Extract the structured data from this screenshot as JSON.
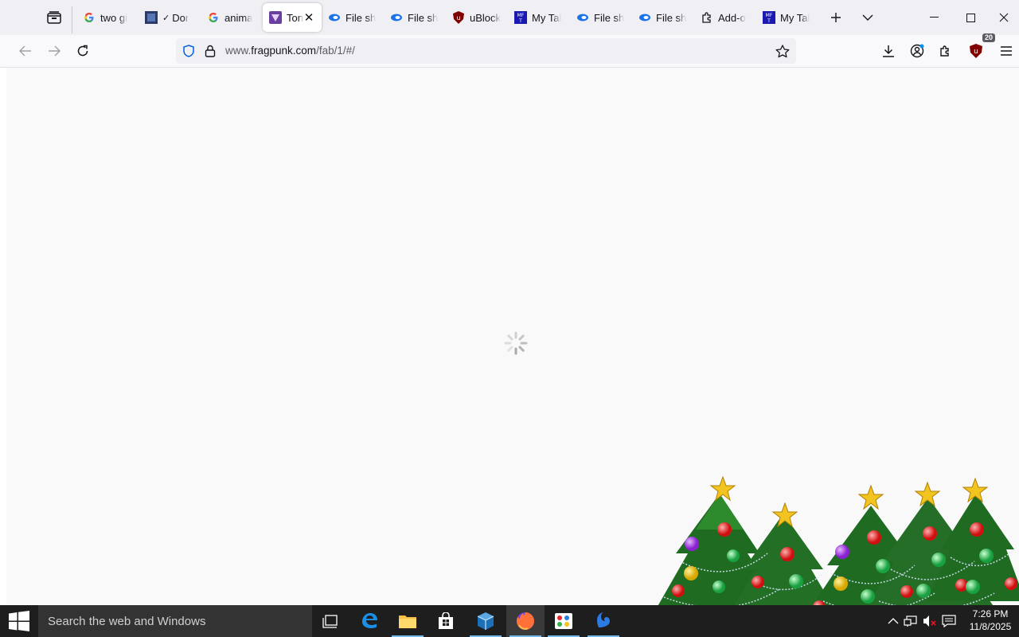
{
  "browser": {
    "tabs": [
      {
        "title": "two gi",
        "favicon": "google-icon",
        "active": false
      },
      {
        "title": "Dor",
        "favicon": "checklist-icon",
        "active": false
      },
      {
        "title": "anima",
        "favicon": "google-icon",
        "active": false
      },
      {
        "title": "Ton",
        "favicon": "site-icon",
        "active": true
      },
      {
        "title": "File sh",
        "favicon": "file-share-icon",
        "active": false
      },
      {
        "title": "File sh",
        "favicon": "file-share-icon",
        "active": false
      },
      {
        "title": "uBlock",
        "favicon": "ublock-icon",
        "active": false
      },
      {
        "title": "My Tal",
        "favicon": "mft-icon",
        "active": false
      },
      {
        "title": "File sh",
        "favicon": "file-share-icon",
        "active": false
      },
      {
        "title": "File sh",
        "favicon": "file-share-icon",
        "active": false
      },
      {
        "title": "Add-o",
        "favicon": "puzzle-icon",
        "active": false
      },
      {
        "title": "My Tal",
        "favicon": "mft-icon",
        "active": false
      }
    ],
    "url": {
      "prefix": "www.",
      "host": "fragpunk.com",
      "path": "/fab/1/#/"
    },
    "ublock_count": "20"
  },
  "page": {
    "state": "loading"
  },
  "taskbar": {
    "search_placeholder": "Search the web and Windows",
    "time": "7:26 PM",
    "date": "11/8/2025"
  },
  "colors": {
    "accent": "#76b9ed",
    "ublock_red": "#800000",
    "taskbar_bg": "#1e1e1e"
  }
}
